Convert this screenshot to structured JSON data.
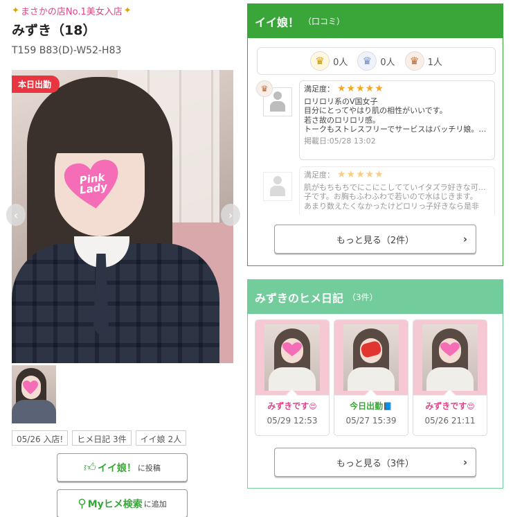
{
  "profile": {
    "catch_copy": "まさかの店No.1美女入店",
    "name": "みずき（18）",
    "spec": "T159 B83(D)-W52-H83",
    "today_badge": "本日出勤",
    "photo_sticker_text": "Pink Lady",
    "prev_icon": "chevron-left-icon",
    "next_icon": "chevron-right-icon"
  },
  "tags": [
    "05/26 入店!",
    "ヒメ日記 3件",
    "イイ娘 2人"
  ],
  "actions": {
    "iiko": {
      "main": "イイ娘！",
      "sub": "に投稿",
      "icon": "thumbs-up-icon"
    },
    "myhime": {
      "main": "Myヒメ検索",
      "sub": "に追加",
      "icon": "search-icon"
    }
  },
  "iiko_panel": {
    "title": "イイ娘！",
    "subtitle": "（口コミ）",
    "crowns": [
      {
        "icon": "gold-crown-icon",
        "count": "0人"
      },
      {
        "icon": "silver-crown-icon",
        "count": "0人"
      },
      {
        "icon": "bronze-crown-icon",
        "count": "1人"
      }
    ],
    "reviews": [
      {
        "satisfaction_label": "満足度：",
        "stars": "★★★★★",
        "lines": [
          "ロリロリ系のV国女子",
          "目分にとってやはり肌の相性がいいです。",
          "若さ故のロリロリ感。",
          "トークもストレスフリーでサービスはバッチリ娘。…"
        ],
        "date": "掲載日:05/28 13:02"
      },
      {
        "satisfaction_label": "満足度：",
        "stars": "★★★★★",
        "lines": [
          "肌がもちもちでにこにこしてていイタズラ好きな可愛い",
          "子です。お胸もふわふわで若いので水はじきます。",
          "あまり数えたくなかったけどロリっ子好きなら是非"
        ],
        "date": ""
      }
    ],
    "more_button": "もっと見る（2件）"
  },
  "diary_panel": {
    "title": "みずきのヒメ日記",
    "subtitle": "（3件）",
    "entries": [
      {
        "title": "みずきです",
        "emoji": "😍",
        "date": "05/29 12:53",
        "title_color": "#e0448a",
        "mark": "heart"
      },
      {
        "title": "今日出勤",
        "emoji": "📘",
        "date": "05/27 15:39",
        "title_color": "#3aa63a",
        "mark": "scribble"
      },
      {
        "title": "みずきです",
        "emoji": "😍",
        "date": "05/26 21:11",
        "title_color": "#e0448a",
        "mark": "heart"
      }
    ],
    "more_button": "もっと見る（3件）"
  },
  "colors": {
    "iiko_green": "#3aa63a",
    "diary_green": "#72cc9c",
    "pink_accent": "#e0448a",
    "today_red": "#e8353f",
    "star_orange": "#f5a623"
  }
}
